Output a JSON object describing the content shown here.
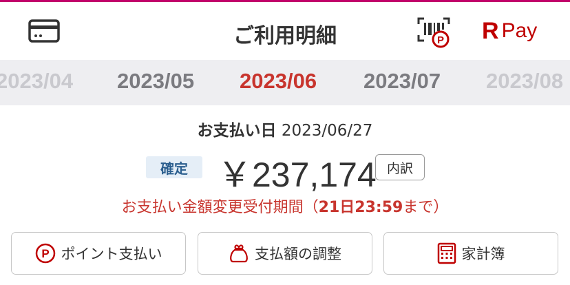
{
  "header": {
    "title": "ご利用明細",
    "brand_r": "R",
    "brand_pay": "Pay"
  },
  "icons": {
    "card": "credit-card-icon",
    "qr": "qr-point-icon",
    "point": "point-circle-icon",
    "adjust": "money-bag-icon",
    "budget": "calculator-icon"
  },
  "months": [
    "2023/04",
    "2023/05",
    "2023/06",
    "2023/07",
    "2023/08"
  ],
  "active_month": "2023/06",
  "summary": {
    "payday_label": "お支払い日",
    "payday_date": "2023/06/27",
    "status": "確定",
    "amount": "￥237,174",
    "detail_label": "内訳",
    "notice_prefix": "お支払い金額変更受付期間（",
    "notice_bold": "21日23:59",
    "notice_suffix": "まで）"
  },
  "actions": {
    "points": "ポイント支払い",
    "adjust": "支払額の調整",
    "budget": "家計簿"
  },
  "colors": {
    "brand": "#bf0000",
    "accent": "#c8352e",
    "status_bg": "#e5eef7",
    "status_text": "#2c5f8f"
  }
}
